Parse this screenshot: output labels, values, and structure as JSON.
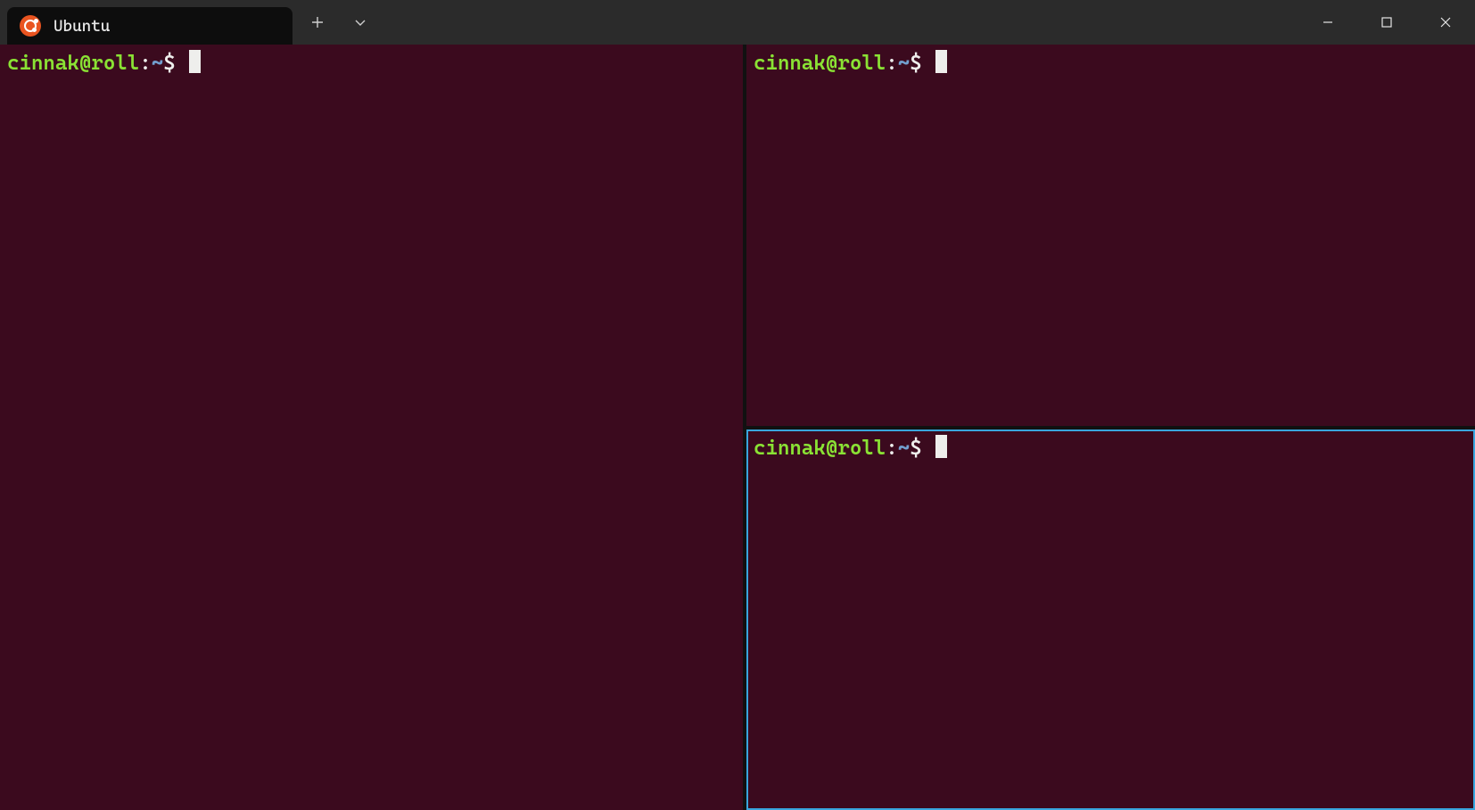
{
  "titlebar": {
    "tab_label": "Ubuntu"
  },
  "panes": {
    "left": {
      "user_host": "cinnak@roll",
      "colon": ":",
      "path": "~",
      "dollar": "$",
      "active": false
    },
    "top_right": {
      "user_host": "cinnak@roll",
      "colon": ":",
      "path": "~",
      "dollar": "$",
      "active": false
    },
    "bottom_right": {
      "user_host": "cinnak@roll",
      "colon": ":",
      "path": "~",
      "dollar": "$",
      "active": true
    }
  },
  "colors": {
    "terminal_bg": "#3b0a1e",
    "accent_active_pane": "#39a5dd",
    "prompt_userhost": "#8ae234",
    "prompt_path": "#729fcf",
    "titlebar_bg": "#2b2b2b",
    "tab_bg": "#0d0d0d",
    "ubuntu_orange": "#E95420"
  }
}
